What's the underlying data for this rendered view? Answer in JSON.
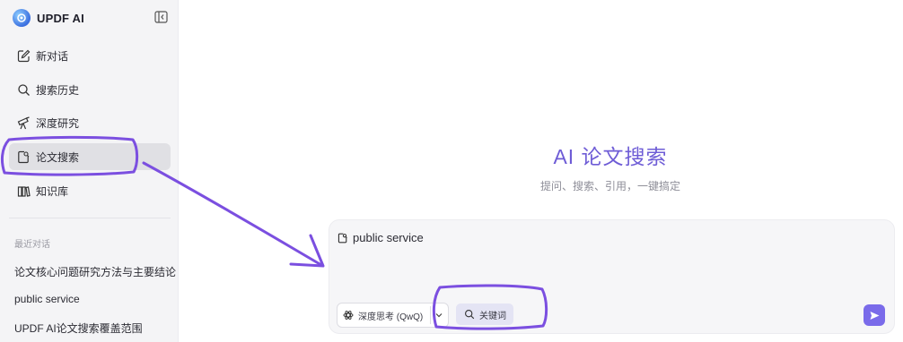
{
  "sidebar": {
    "brand": "UPDF AI",
    "nav": [
      {
        "label": "新对话",
        "icon": "edit-icon"
      },
      {
        "label": "搜索历史",
        "icon": "search-icon"
      },
      {
        "label": "深度研究",
        "icon": "telescope-icon"
      },
      {
        "label": "论文搜索",
        "icon": "paper-search-icon",
        "active": true
      },
      {
        "label": "知识库",
        "icon": "library-icon"
      }
    ],
    "recent_label": "最近对话",
    "recent": [
      "论文核心问题研究方法与主要结论",
      "public service",
      "UPDF AI论文搜索覆盖范围"
    ]
  },
  "main": {
    "title": "AI 论文搜索",
    "subtitle": "提问、搜索、引用，一键搞定",
    "composer": {
      "query": "public service",
      "model": "深度思考 (QwQ)",
      "keyword_button": "关键词"
    }
  },
  "colors": {
    "accent": "#6e5cd6",
    "annotation": "#7b4fe0",
    "send_button": "#7a6bea"
  }
}
